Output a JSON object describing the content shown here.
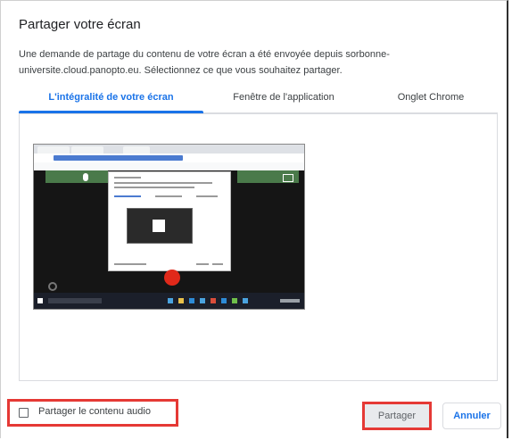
{
  "dialog": {
    "title": "Partager votre écran",
    "description_line1": "Une demande de partage du contenu de votre écran a été envoyée depuis sorbonne-",
    "description_line2": "universite.cloud.panopto.eu. Sélectionnez ce que vous souhaitez partager."
  },
  "tabs": [
    {
      "label": "L'intégralité de votre écran",
      "active": true
    },
    {
      "label": "Fenêtre de l'application",
      "active": false
    },
    {
      "label": "Onglet Chrome",
      "active": false
    }
  ],
  "audio": {
    "label": "Partager le contenu audio",
    "checked": false
  },
  "buttons": {
    "share": "Partager",
    "cancel": "Annuler"
  },
  "colors": {
    "accent": "#1a73e8",
    "highlight": "#e53935"
  }
}
